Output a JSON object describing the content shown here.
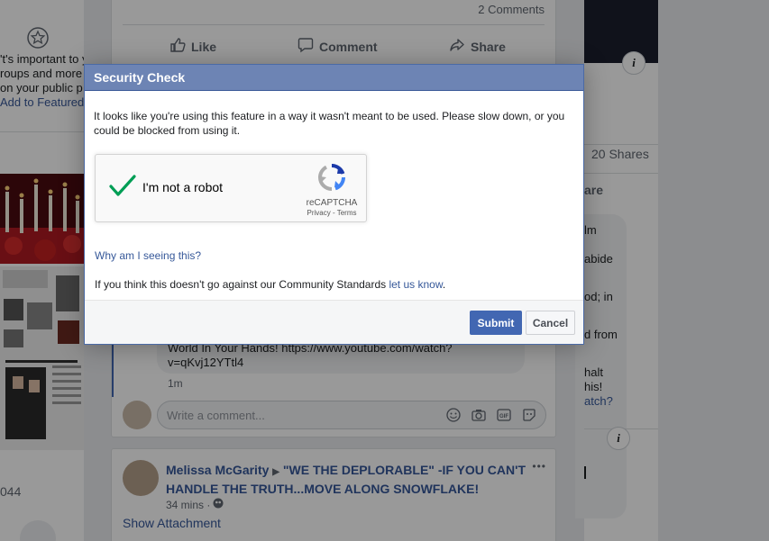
{
  "left": {
    "line1": "'t's important to y",
    "line2": "roups and more t",
    "line3": " on your public p",
    "link": "Add to Featured",
    "count": "044"
  },
  "post_top": {
    "comments": "2 Comments",
    "like": "Like",
    "comment": "Comment",
    "share": "Share"
  },
  "right": {
    "shares": "20 Shares",
    "share_frag": "are",
    "frags": [
      "lm",
      "abide",
      "od; in",
      "d from",
      "halt",
      "his!",
      "atch?"
    ]
  },
  "comment_snippet": {
    "text1": "World In Your Hands! https://www.youtube.com/watch?",
    "text2": "v=qKvj12YTtl4",
    "time": "1m",
    "placeholder": "Write a comment..."
  },
  "post2": {
    "author": "Melissa McGarity",
    "group": "\"WE THE DEPLORABLE\" -IF YOU CAN'T HANDLE THE TRUTH...MOVE ALONG SNOWFLAKE!",
    "time": "34 mins ·",
    "attachment": "Show Attachment",
    "more": "•••"
  },
  "dialog": {
    "title": "Security Check",
    "message": "It looks like you're using this feature in a way it wasn't meant to be used. Please slow down, or you could be blocked from using it.",
    "captcha_label": "I'm not a robot",
    "captcha_brand": "reCAPTCHA",
    "captcha_terms": "Privacy - Terms",
    "why": "Why am I seeing this?",
    "standards_prefix": "If you think this doesn't go against our Community Standards ",
    "standards_link": "let us know",
    "standards_suffix": ".",
    "submit": "Submit",
    "cancel": "Cancel"
  },
  "colors": {
    "header": "#6d84b4",
    "submit": "#4267b2",
    "link": "#365899",
    "check": "#009e55"
  }
}
